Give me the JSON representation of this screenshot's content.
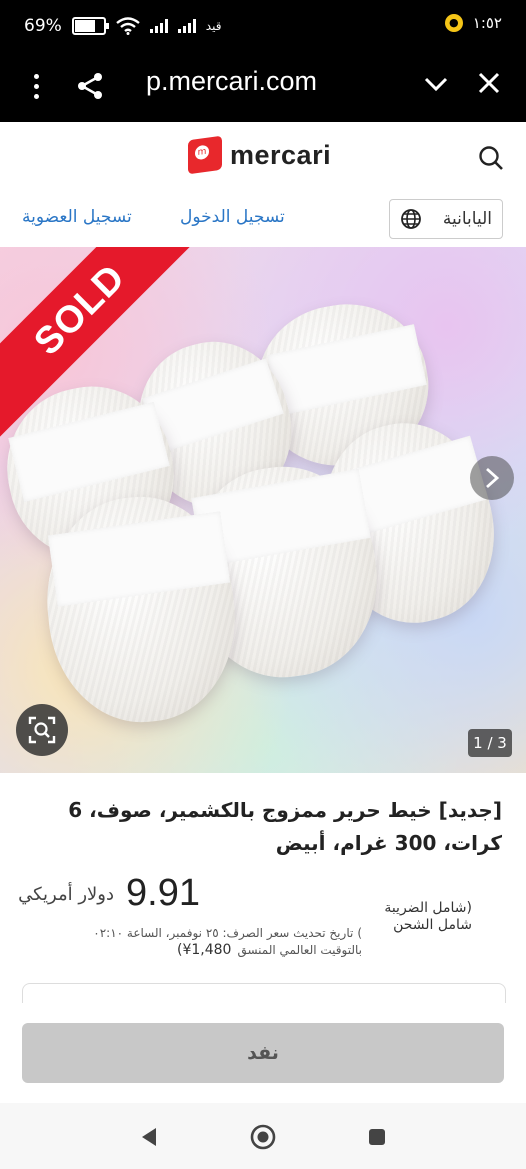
{
  "status_bar": {
    "battery": "69%",
    "carrier": "قيد",
    "time": "١:٥٢",
    "battery_level": 0.69
  },
  "browser": {
    "url": "p.mercari.com"
  },
  "header": {
    "brand": "mercari",
    "language_button": "اليابانية",
    "login_link": "تسجيل الدخول",
    "signup_link": "تسجيل العضوية"
  },
  "product": {
    "sold_badge": "SOLD",
    "image_counter": "1 / 3",
    "title": "[جديد] خيط حرير ممزوج بالكشمير، صوف، 6 كرات، 300 غرام، أبيض",
    "price": "9.91",
    "currency": "دولار أمريكي",
    "tax_note_line1": "(شامل الضريبة",
    "tax_note_line2": "شامل الشحن",
    "tax_note_line3": ")",
    "rate_note": "تاريخ تحديث سعر الصرف: ٢٥ نوفمبر، الساعة ٠٢:١٠",
    "rate_note_line2": "بالتوقيت العالمي المنسق",
    "yen_price": "(¥1,480"
  },
  "actions": {
    "sold_out_button": "نفد"
  }
}
